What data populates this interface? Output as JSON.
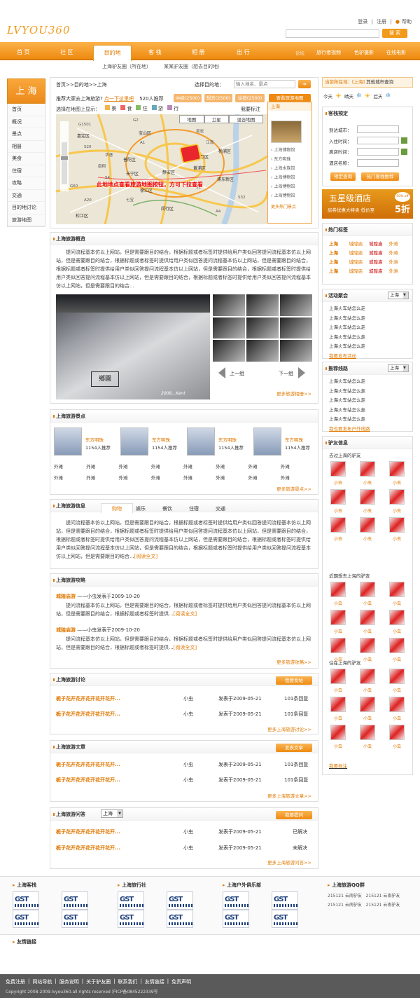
{
  "header": {
    "logo": "LVYOU360",
    "links": [
      "登录",
      "|",
      "注册",
      "|",
      "帮助"
    ],
    "search_btn": "搜 索"
  },
  "nav": {
    "items": [
      "首 页",
      "社 区",
      "目的地",
      "客 栈",
      "相 册",
      "出 行"
    ],
    "right": [
      "旅行者视频",
      "色驴摄影",
      "在线电影"
    ],
    "bullet": "论坛"
  },
  "subnav": [
    "上海驴友圈（所在地）",
    "某某驴友圈（想去目的地）"
  ],
  "left": {
    "city": "上 海",
    "menu": [
      "首页",
      "概况",
      "景点",
      "相册",
      "美食",
      "住宿",
      "攻略",
      "交通",
      "目的地讨论",
      "旅游地图"
    ]
  },
  "breadcrumb": "首页>>目的地>>上海",
  "choose_label": "选择目的地：",
  "choose_placeholder": "输入地名、景点",
  "visit_prompt": "推荐大家去上海旅游?",
  "visit_link": "点一下这里吧",
  "visit_count": "520人推荐",
  "tabs3": [
    "中经(2500)",
    "想去(2500)",
    "住宿(2500)"
  ],
  "mapsel": "查看旅游地图",
  "map": {
    "show_label": "选择在地图上显示：",
    "filters": [
      "景",
      "食",
      "住",
      "游",
      "行"
    ],
    "mark": "我要标注",
    "types": [
      "地图",
      "卫星",
      "混合地图"
    ],
    "overlay": "此地地点查看旅游地图按钮，方可下拉查看",
    "side_title": "上海",
    "side_items": [
      "上海博物馆",
      "东方明珠",
      "上海水族馆",
      "上海博物馆",
      "上海博物馆",
      "上海博物馆"
    ],
    "side_more": "更多热门景点",
    "labels": [
      "G1501",
      "G2",
      "S20",
      "A1",
      "A20",
      "S4",
      "G60",
      "S32",
      "A4",
      "S1",
      "嘉定区",
      "宝山区",
      "闵行区",
      "松江区",
      "浦东新区",
      "杨浦区",
      "普陀区",
      "静安区",
      "徐汇区",
      "黄浦区",
      "长宁区",
      "虹口区",
      "南翔",
      "七宝",
      "华漕",
      "江湾",
      "吴淞"
    ]
  },
  "overview": {
    "title": "上海旅游概览",
    "text": "提问流程基本仿以上网站，但是需要跟目的结合，根据标题或者标签时提供给用户类似回答提问流程基本仿以上网站，但是需要跟目的结合，根据标题或者标签时提供给用户类似回答提问流程基本仿以上网站，但是需要跟目的结合，根据标题或者标签时提供给用户类似回答提问流程基本仿以上网站，但是需要跟目的结合，根据标题或者标签时提供给用户类似回答提问流程基本仿以上网站，但是需要跟目的结合，根据标题或者标签时提供给用户类似回答提问流程基本仿以上网站，但是需要跟目的结合...",
    "photo_text": "2008...Kent",
    "photo_sign": "鄉園",
    "prev": "上一组",
    "next": "下一组",
    "more": "更多旅游相册>>"
  },
  "spots": {
    "title": "上海旅游景点",
    "items": [
      {
        "name": "东方明珠",
        "count": "1154人推荐"
      },
      {
        "name": "东方明珠",
        "count": "1154人推荐"
      },
      {
        "name": "东方明珠",
        "count": "1154人推荐"
      },
      {
        "name": "东方明珠",
        "count": "1154人推荐"
      }
    ],
    "small": "外滩",
    "more": "更多旅游景点>>"
  },
  "info": {
    "title": "上海旅游信息",
    "tabs": [
      "购物",
      "娱乐",
      "餐饮",
      "住宿",
      "交通"
    ],
    "text": "提问流程基本仿以上网站，但是需要跟目的结合，根据标题或者标签时提供给用户类似回答提问流程基本仿以上网站，但是需要跟目的结合，根据标题或者标签时提供给用户类似回答提问流程基本仿以上网站，但是需要跟目的结合，根据标题或者标签时提供给用户类似回答提问流程基本仿以上网站，但是需要跟目的结合，根据标题或者标签时提供给用户类似回答提问流程基本仿以上网站，但是需要跟目的结合，根据标题或者标签时提供给用户类似回答提问流程基本仿以上网站，但是需要跟目的结合...",
    "read": "[阅读全文]"
  },
  "guide": {
    "title": "上海旅游攻略",
    "items": [
      {
        "name": "城隍庙游",
        "meta": "——小虫发表于2009-10-20",
        "text": "提问流程基本仿以上网站，但是需要跟目的结合，根据标题或者标签时提供给用户类似回答提问流程基本仿以上网站，但是需要跟目的结合，根据标题或者标签时提供...",
        "read": "[阅读全文]"
      },
      {
        "name": "城隍庙游",
        "meta": "——小虫发表于2009-10-20",
        "text": "提问流程基本仿以上网站，但是需要跟目的结合，根据标题或者标签时提供给用户类似回答提问流程基本仿以上网站，但是需要跟目的结合，根据标题或者标签时提供...",
        "read": "[阅读全文]"
      }
    ],
    "more": "更多旅游攻略>>"
  },
  "discuss": {
    "title": "上海旅游讨论",
    "btn": "我要发帖",
    "rows": [
      {
        "t": "栀子花开花开花开花开花开...",
        "u": "小虫",
        "d": "发表于2009-05-21",
        "n": "101条回复"
      },
      {
        "t": "栀子花开花开花开花开花开...",
        "u": "小虫",
        "d": "发表于2009-05-21",
        "n": "101条回复"
      }
    ],
    "more": "更多上海旅游讨论>>"
  },
  "articles": {
    "title": "上海旅游文章",
    "btn": "发表文章",
    "rows": [
      {
        "t": "栀子花开花开花开花开花开...",
        "u": "小虫",
        "d": "发表于2009-05-21",
        "n": "101条回复"
      },
      {
        "t": "栀子花开花开花开花开花开...",
        "u": "小虫",
        "d": "发表于2009-05-21",
        "n": "101条回复"
      }
    ],
    "more": "更多上海旅游文章>>"
  },
  "qa": {
    "title": "上海旅游问答",
    "sel": "上海",
    "btn": "我要提问",
    "rows": [
      {
        "t": "栀子花开花开花开花开花开...",
        "u": "小虫",
        "d": "发表于2009-05-21",
        "n": "已解决"
      },
      {
        "t": "栀子花开花开花开花开花开...",
        "u": "小虫",
        "d": "发表于2009-05-21",
        "n": "未解决"
      }
    ],
    "more": "更多上海旅游问答>>"
  },
  "right": {
    "loc": "当前所在地：[上海]",
    "loc_link": "其他城市查询",
    "weather": [
      "今天",
      "晴天",
      "后天"
    ],
    "hotel": {
      "title": "客栈预定",
      "fields": [
        "到达城市：",
        "入住时间：",
        "离店时间：",
        "酒店名称："
      ],
      "btns": [
        "预定查询",
        "热门客栈推荐"
      ]
    },
    "ad": {
      "title": "五星级酒店",
      "sub": "房券优惠大特卖 低价至",
      "big": "5折",
      "off": "50% off"
    },
    "tags": {
      "title": "热门标签",
      "rows": [
        [
          "上海",
          "城隍庙",
          "城隍庙",
          "外滩"
        ],
        [
          "上海",
          "城隍庙",
          "城隍庙",
          "外滩"
        ],
        [
          "上海",
          "城隍庙",
          "城隍庙",
          "外滩"
        ],
        [
          "上海",
          "城隍庙",
          "城隍庙",
          "外滩"
        ]
      ]
    },
    "events": {
      "title": "活动聚会",
      "sel": "上海",
      "items": [
        "上海火车站怎么走",
        "上海火车站怎么走",
        "上海火车站怎么走",
        "上海火车站怎么走",
        "上海火车站怎么走"
      ],
      "link": "我要发布活动"
    },
    "routes": {
      "title": "推荐线路",
      "sel": "上海",
      "items": [
        "上海火车站怎么走",
        "上海火车站怎么走",
        "上海火车站怎么走",
        "上海火车站怎么走",
        "上海火车站怎么走"
      ],
      "link": "我也要发布户外线路"
    },
    "friends": {
      "title": "驴友信息",
      "groups": [
        "去过上海的驴友",
        "近期想去上海的驴友",
        "住在上海的驴友"
      ],
      "name": "小虫",
      "link": "我要标注"
    }
  },
  "footer_blocks": [
    {
      "title": "上海客栈"
    },
    {
      "title": "上海旅行社"
    },
    {
      "title": "上海户外俱乐部"
    },
    {
      "title": "上海旅游QQ群",
      "qq": [
        [
          "215121",
          "云南驴友",
          "215121",
          "云南驴友"
        ],
        [
          "215121",
          "云南驴友",
          "215121",
          "云南驴友"
        ]
      ]
    }
  ],
  "badge_text": "GST",
  "friendlinks": "友情链接",
  "footer": {
    "links": [
      "免费注册",
      "|",
      "网站导航",
      "|",
      "服务说明",
      "|",
      "关于驴友圈",
      "|",
      "联系我们",
      "|",
      "友情链接",
      "|",
      "免责声明"
    ],
    "copy": "Copyright 2008-2009.lvyou360.all rights reserved 沪ICP备0845222339号"
  }
}
